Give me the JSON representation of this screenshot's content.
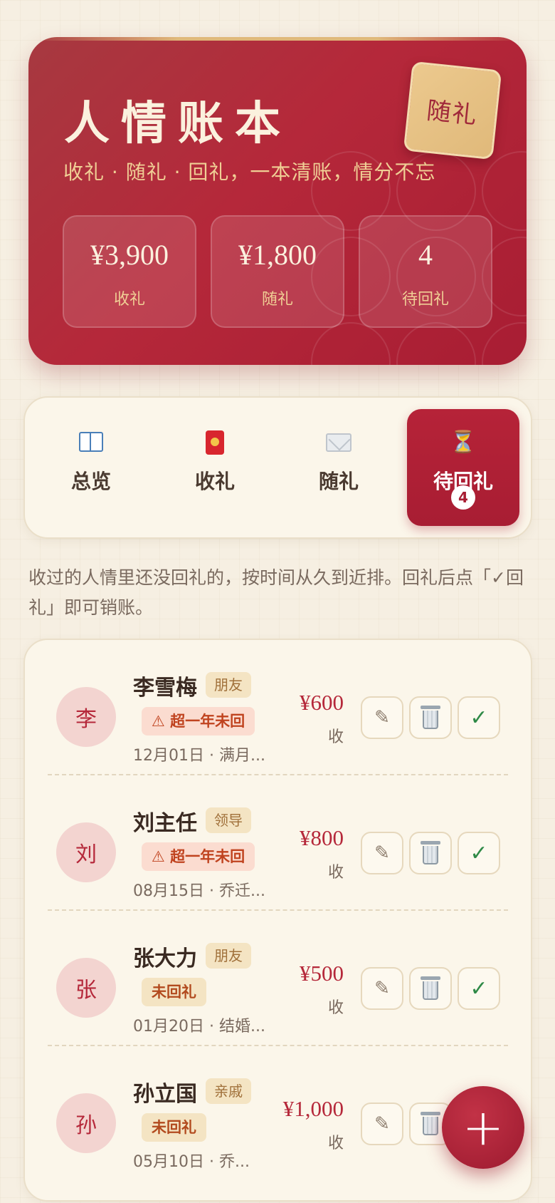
{
  "hero": {
    "title": "人情账本",
    "subtitle": "收礼 · 随礼 · 回礼，一本清账，情分不忘",
    "seal": "随礼",
    "stats": [
      {
        "value": "¥3,900",
        "label": "收礼"
      },
      {
        "value": "¥1,800",
        "label": "随礼"
      },
      {
        "value": "4",
        "label": "待回礼"
      }
    ]
  },
  "tabs": [
    {
      "label": "总览",
      "icon": "book-icon"
    },
    {
      "label": "收礼",
      "icon": "red-packet-icon"
    },
    {
      "label": "随礼",
      "icon": "envelope-icon"
    },
    {
      "label": "待回礼",
      "icon": "hourglass-icon",
      "badge": "4",
      "active": true
    }
  ],
  "hint": "收过的人情里还没回礼的，按时间从久到近排。回礼后点「✓回礼」即可销账。",
  "records": [
    {
      "avatar": "李",
      "name": "李雪梅",
      "tag": "朋友",
      "status": "⚠ 超一年未回",
      "meta": "12月01日 · 满月...",
      "amount": "¥600",
      "type": "收"
    },
    {
      "avatar": "刘",
      "name": "刘主任",
      "tag": "领导",
      "status": "⚠ 超一年未回",
      "meta": "08月15日 · 乔迁...",
      "amount": "¥800",
      "type": "收"
    },
    {
      "avatar": "张",
      "name": "张大力",
      "tag": "朋友",
      "status": "未回礼",
      "meta": "01月20日 · 结婚...",
      "amount": "¥500",
      "type": "收"
    },
    {
      "avatar": "孙",
      "name": "孙立国",
      "tag": "亲戚",
      "status": "未回礼",
      "meta": "05月10日 · 乔...",
      "amount": "¥1,000",
      "type": "收"
    }
  ],
  "buttons": {
    "edit": "✎",
    "check": "✓"
  },
  "fab": "+",
  "colors": {
    "primary": "#a81d33",
    "gold": "#e0b97a",
    "background": "#f6efe2"
  }
}
